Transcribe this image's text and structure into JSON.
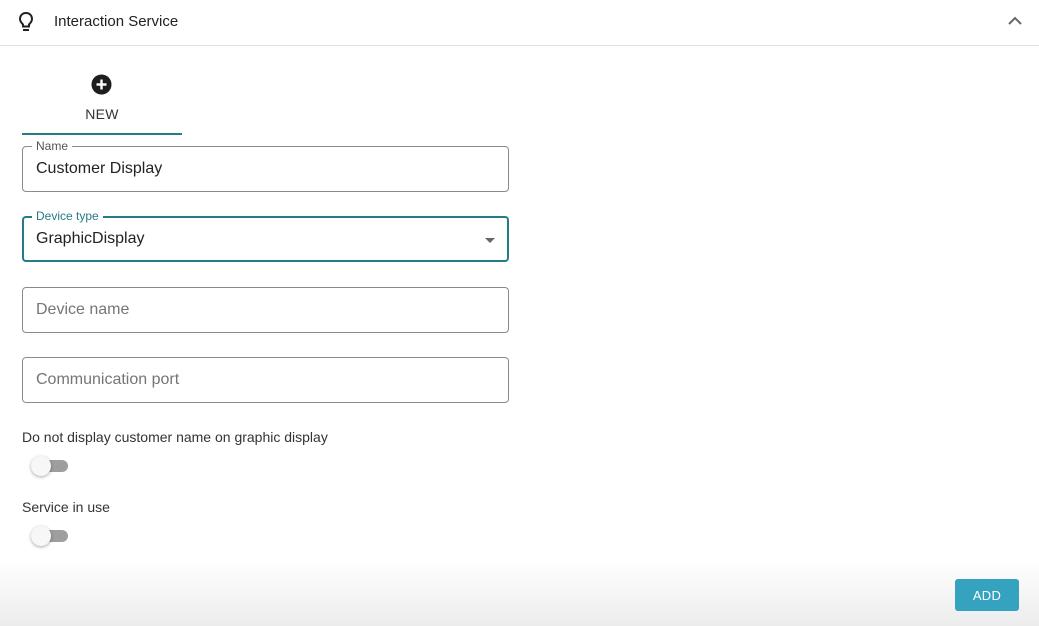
{
  "header": {
    "icon": "lightbulb-icon",
    "title": "Interaction Service",
    "collapse_icon": "chevron-up-icon"
  },
  "tabs": [
    {
      "label": "NEW",
      "icon": "add-circle-icon",
      "active": true
    }
  ],
  "form": {
    "name": {
      "label": "Name",
      "value": "Customer Display"
    },
    "device_type": {
      "label": "Device type",
      "value": "GraphicDisplay",
      "icon": "dropdown-arrow-icon"
    },
    "device_name": {
      "placeholder": "Device name",
      "value": ""
    },
    "communication_port": {
      "placeholder": "Communication port",
      "value": ""
    },
    "toggles": [
      {
        "label": "Do not display customer name on graphic display",
        "checked": false
      },
      {
        "label": "Service in use",
        "checked": false
      }
    ]
  },
  "actions": {
    "add_label": "ADD"
  },
  "colors": {
    "accent": "#257b86",
    "button": "#35a3c0",
    "switch_track": "#9e9e9e"
  }
}
